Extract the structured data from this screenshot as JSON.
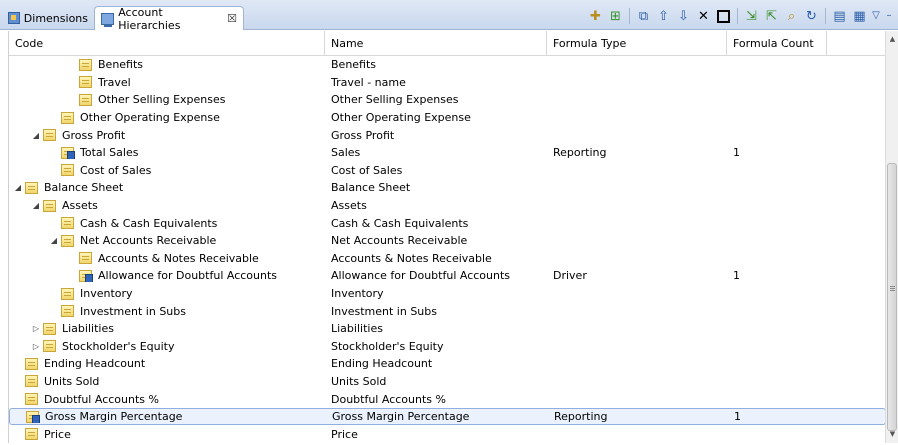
{
  "tabs": [
    {
      "label": "Dimensions",
      "icon": "dimensions-icon"
    },
    {
      "label": "Account Hierarchies",
      "icon": "hierarchy-icon",
      "close": "☒"
    }
  ],
  "toolbar": {
    "icons": [
      "new-child-icon",
      "new-sibling-icon",
      "copy-icon",
      "move-up-icon",
      "move-down-icon",
      "delete-icon",
      "select-box-icon",
      "expand-icon",
      "collapse-icon",
      "find-icon",
      "refresh-icon",
      "layout-icon",
      "grid-icon",
      "view-menu-icon",
      "minimize-icon"
    ],
    "delete_glyph": "✕",
    "menu_glyph": "▽",
    "minimize_glyph": "–"
  },
  "columns": {
    "code": "Code",
    "name": "Name",
    "formula_type": "Formula Type",
    "formula_count": "Formula Count"
  },
  "rows": [
    {
      "code": "Benefits",
      "name": "Benefits",
      "formula_type": "",
      "formula_count": "",
      "depth": 3,
      "twisty": "",
      "formula": false
    },
    {
      "code": "Travel",
      "name": "Travel - name",
      "formula_type": "",
      "formula_count": "",
      "depth": 3,
      "twisty": "",
      "formula": false
    },
    {
      "code": "Other Selling Expenses",
      "name": "Other Selling Expenses",
      "formula_type": "",
      "formula_count": "",
      "depth": 3,
      "twisty": "",
      "formula": false
    },
    {
      "code": "Other Operating Expense",
      "name": "Other Operating Expense",
      "formula_type": "",
      "formula_count": "",
      "depth": 2,
      "twisty": "",
      "formula": false
    },
    {
      "code": "Gross Profit",
      "name": "Gross Profit",
      "formula_type": "",
      "formula_count": "",
      "depth": 1,
      "twisty": "◢",
      "formula": false
    },
    {
      "code": "Total Sales",
      "name": "Sales",
      "formula_type": "Reporting",
      "formula_count": "1",
      "depth": 2,
      "twisty": "",
      "formula": true
    },
    {
      "code": "Cost of Sales",
      "name": "Cost of Sales",
      "formula_type": "",
      "formula_count": "",
      "depth": 2,
      "twisty": "",
      "formula": false
    },
    {
      "code": "Balance Sheet",
      "name": "Balance Sheet",
      "formula_type": "",
      "formula_count": "",
      "depth": 0,
      "twisty": "◢",
      "formula": false
    },
    {
      "code": "Assets",
      "name": "Assets",
      "formula_type": "",
      "formula_count": "",
      "depth": 1,
      "twisty": "◢",
      "formula": false
    },
    {
      "code": "Cash & Cash Equivalents",
      "name": "Cash & Cash Equivalents",
      "formula_type": "",
      "formula_count": "",
      "depth": 2,
      "twisty": "",
      "formula": false
    },
    {
      "code": "Net Accounts Receivable",
      "name": "Net Accounts Receivable",
      "formula_type": "",
      "formula_count": "",
      "depth": 2,
      "twisty": "◢",
      "formula": false
    },
    {
      "code": "Accounts & Notes Receivable",
      "name": "Accounts & Notes Receivable",
      "formula_type": "",
      "formula_count": "",
      "depth": 3,
      "twisty": "",
      "formula": false
    },
    {
      "code": "Allowance for Doubtful Accounts",
      "name": "Allowance for Doubtful Accounts",
      "formula_type": "Driver",
      "formula_count": "1",
      "depth": 3,
      "twisty": "",
      "formula": true
    },
    {
      "code": "Inventory",
      "name": "Inventory",
      "formula_type": "",
      "formula_count": "",
      "depth": 2,
      "twisty": "",
      "formula": false
    },
    {
      "code": "Investment in Subs",
      "name": "Investment in Subs",
      "formula_type": "",
      "formula_count": "",
      "depth": 2,
      "twisty": "",
      "formula": false
    },
    {
      "code": "Liabilities",
      "name": "Liabilities",
      "formula_type": "",
      "formula_count": "",
      "depth": 1,
      "twisty": "▷",
      "formula": false
    },
    {
      "code": "Stockholder's Equity",
      "name": "Stockholder's Equity",
      "formula_type": "",
      "formula_count": "",
      "depth": 1,
      "twisty": "▷",
      "formula": false
    },
    {
      "code": "Ending Headcount",
      "name": "Ending Headcount",
      "formula_type": "",
      "formula_count": "",
      "depth": 0,
      "twisty": "",
      "formula": false
    },
    {
      "code": "Units Sold",
      "name": "Units Sold",
      "formula_type": "",
      "formula_count": "",
      "depth": 0,
      "twisty": "",
      "formula": false
    },
    {
      "code": "Doubtful Accounts %",
      "name": "Doubtful Accounts %",
      "formula_type": "",
      "formula_count": "",
      "depth": 0,
      "twisty": "",
      "formula": false
    },
    {
      "code": "Gross Margin Percentage",
      "name": "Gross Margin Percentage",
      "formula_type": "Reporting",
      "formula_count": "1",
      "depth": 0,
      "twisty": "",
      "formula": true,
      "selected": true
    },
    {
      "code": "Price",
      "name": "Price",
      "formula_type": "",
      "formula_count": "",
      "depth": 0,
      "twisty": "",
      "formula": false
    }
  ]
}
